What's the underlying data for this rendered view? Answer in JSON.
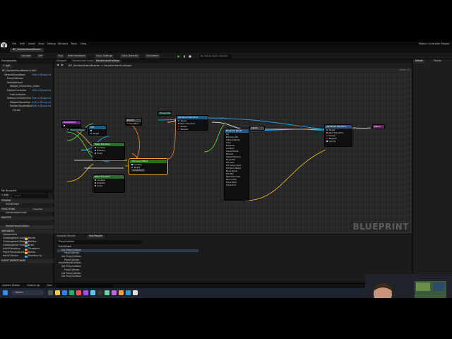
{
  "app": {
    "menu": [
      "File",
      "Edit",
      "Asset",
      "View",
      "Debug",
      "Window",
      "Tools",
      "Help"
    ],
    "product": "Motion Controller Master",
    "logo": "U"
  },
  "tabs": [
    {
      "label": "BP_SkeletalHandMaster",
      "active": true
    },
    {
      "label": "ConstructionScr",
      "active": false
    },
    {
      "label": "HandleHandCol",
      "active": false
    },
    {
      "label": "EventGraph",
      "active": false
    }
  ],
  "toolbar": {
    "compile": "Compile",
    "save": "Save",
    "browse": "Browse",
    "diff": "Diff",
    "find": "Find",
    "hide": "Hide Unrelated",
    "class_settings": "Class Settings",
    "class_defaults": "Class Defaults",
    "simulation": "Simulation",
    "debug_filter": "No debug object selected"
  },
  "components": {
    "header": "Components",
    "add": "+ Add",
    "items": [
      {
        "name": "BP_SkeletalHandMaster (Self)",
        "link": ""
      },
      {
        "name": "DefaultSceneRoot",
        "link": "Edit in Blueprint"
      },
      {
        "name": "ProxyCollision",
        "link": ""
      },
      {
        "name": "SkeletalHand",
        "link": ""
      },
      {
        "name": "Widget_Interaction_Index",
        "link": ""
      },
      {
        "name": "MotionController",
        "link": "Edit in Blueprint"
      },
      {
        "name": "SubController",
        "link": ""
      },
      {
        "name": "MotionControllerAim",
        "link": "Edit in Blueprint"
      },
      {
        "name": "WidgetInteraction",
        "link": "Edit in Blueprint"
      },
      {
        "name": "PointerVisualization",
        "link": "Edit in Blueprint"
      },
      {
        "name": "Cursor",
        "link": ""
      }
    ]
  },
  "my_blueprint": {
    "header": "My Blueprint",
    "add": "+ Add",
    "search": "Search",
    "sections": {
      "graphs": "GRAPHS",
      "functions": "FUNCTIONS",
      "override": "Override",
      "macros": "MACROS",
      "variables": "VARIABLES",
      "dispatchers": "EVENT DISPATCHERS"
    },
    "graph_items": [
      "EventGraph"
    ],
    "function_items": [
      "ConstructionScript",
      "HandleHandCollision"
    ],
    "variables_group": "Components",
    "variables": [
      {
        "name": "ClimbingHand Location",
        "type": "Vector"
      },
      {
        "name": "ClimbingHand Rotation",
        "type": "Rotator"
      },
      {
        "name": "ClimbingActor Grabbed",
        "type": "Actor"
      },
      {
        "name": "InitialTransform",
        "type": "Transform"
      },
      {
        "name": "PlayerPreviousLocation",
        "type": "Vector"
      },
      {
        "name": "HandCollision",
        "type": "Primitive Co"
      }
    ]
  },
  "graph": {
    "tabs": [
      "Viewport",
      "Construction Script",
      "HandleHandCollision"
    ],
    "breadcrumb": "BP_SkeletalHandMaster > HandleHandCollision",
    "zoom": "Zoom -5",
    "watermark": "BLUEPRINT",
    "nodes": {
      "entry": "HandleHand",
      "branch": "Branch",
      "set_var": "SET",
      "break_hit": "Break Hit Result",
      "select": "Select",
      "make_transform": "Make Transform",
      "make_transform2": "Make Transform",
      "literal": "0.0  0.0  0.0",
      "add_local": "Add Local Offset",
      "set_world": "Set World Transform",
      "return": "Return",
      "proxy": "ProxyCollision",
      "get_hit": "Hand Collision"
    },
    "pin_labels": {
      "target": "Target",
      "location": "Location",
      "rotation": "Rotation",
      "scale": "Scale",
      "return_value": "Return Value",
      "condition": "Condition",
      "true": "True",
      "false": "False",
      "sweep": "Sweep",
      "teleport": "Teleport",
      "new_transform": "New Transform",
      "out_hit": "Out Hit",
      "hit": "Hit",
      "blocking": "Blocking Hit",
      "initial": "Initial Overlap",
      "time": "Time",
      "distance": "Distance",
      "impact_point": "Impact Point",
      "normal": "Normal",
      "impact_normal": "Impact Normal",
      "phys_mat": "Phys Mat",
      "hit_actor": "Hit Actor",
      "hit_component": "Hit Component",
      "hit_bone": "Hit Bone Name",
      "bone_name": "Bone Name",
      "hit_item": "Hit Item",
      "element": "Element Index",
      "face": "Face Index",
      "trace_start": "Trace Start",
      "trace_end": "Trace End"
    }
  },
  "find_results": {
    "tabs": [
      "Compiler Results",
      "Find Results"
    ],
    "query": "ProxyCollision",
    "rows": [
      "EventGraph",
      "Get ProxyCollision",
      "ProxyCollision",
      "Get ProxyCollision",
      "ProxyCollision",
      "HandleHandCollision",
      "Get ProxyCollision",
      "ProxyCollision",
      "Set ProxyCollision",
      "Get ProxyCollision"
    ]
  },
  "details": {
    "tabs": [
      "Details",
      "Palette"
    ]
  },
  "statusbar": {
    "content_drawer": "Content Drawer",
    "output_log": "Output Log",
    "cmd": "Cmd"
  },
  "taskbar": {
    "search": "Search"
  },
  "colors": {
    "exec": "#ffffff",
    "vector": "#f5c02b",
    "object": "#28a9f0",
    "bool": "#a51818",
    "transform": "#f28d22",
    "float": "#6ae13c",
    "accent": "#f2a431"
  }
}
